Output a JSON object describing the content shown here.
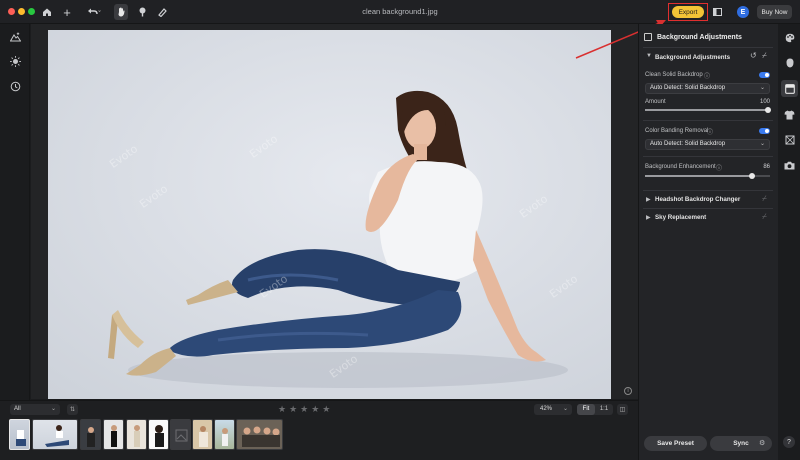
{
  "window": {
    "title": "clean background1.jpg",
    "export_label": "Export",
    "avatar_letter": "E",
    "buy_now_label": "Buy Now",
    "traffic_colors": [
      "#fe5f57",
      "#febc2e",
      "#28c840"
    ]
  },
  "toolbar": {
    "icons": [
      "home-icon",
      "add-icon",
      "undo-icon",
      "hand-icon",
      "brush-icon",
      "eraser-icon"
    ]
  },
  "canvas": {
    "watermark": "Evoto",
    "accent_arrow_color": "#e02f2f"
  },
  "bottom": {
    "filter_value": "All",
    "zoom_value": "42%",
    "fit_label": "Fit",
    "one_to_one_label": "1:1",
    "rating_stars": 5
  },
  "panel": {
    "header": "Background Adjustments",
    "section_title": "Background Adjustments",
    "clean_solid_backdrop_label": "Clean Solid Backdrop",
    "clean_solid_backdrop_mode": "Auto Detect: Solid Backdrop",
    "amount_label": "Amount",
    "amount_value": "100",
    "color_banding_label": "Color Banding Removal",
    "color_banding_mode": "Auto Detect: Solid Backdrop",
    "bg_enhancement_label": "Background Enhancement",
    "bg_enhancement_value": "86",
    "headshot_backdrop_label": "Headshot Backdrop Changer",
    "sky_replacement_label": "Sky Replacement",
    "save_preset_label": "Save Preset",
    "sync_label": "Sync"
  },
  "help_label": "?"
}
